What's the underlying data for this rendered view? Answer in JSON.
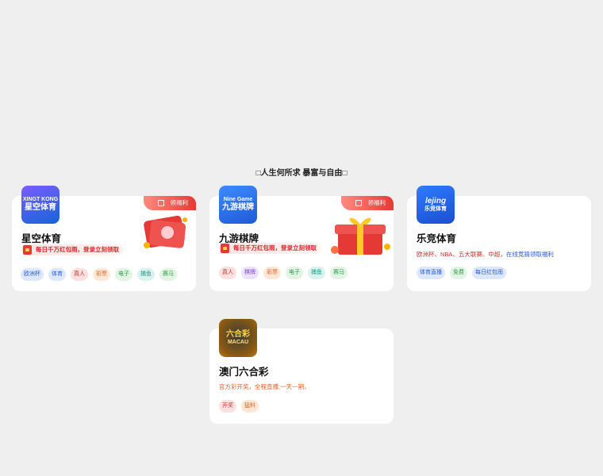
{
  "headline": "□人生何所求 暴富与自由□",
  "cards": [
    {
      "logo_line1": "XINGT KONG",
      "logo_line2": "星空体育",
      "title": "星空体育",
      "ribbon": "领福利",
      "promo": "每日千万红包雨，登录立刻领取",
      "tags": [
        "欧洲杯",
        "体育",
        "真人",
        "彩票",
        "电子",
        "捕鱼",
        "赛马"
      ]
    },
    {
      "logo_line1": "Nine Game",
      "logo_line2": "九游棋牌",
      "title": "九游棋牌",
      "ribbon": "领福利",
      "promo": "每日千万红包雨，登录立刻领取",
      "tags": [
        "真人",
        "棋牌",
        "彩票",
        "电子",
        "捕鱼",
        "赛马"
      ]
    },
    {
      "logo_line1": "lejing",
      "logo_line2": "乐竞体育",
      "title": "乐竞体育",
      "desc_red": "欧洲杯、NBA、五大联赛、中超，",
      "desc_blue": "在线竞猜领取福利",
      "tags": [
        "体育直播",
        "免费",
        "每日红包雨"
      ]
    },
    {
      "logo_line1": "六合彩",
      "logo_line2": "MACAU",
      "title": "澳门六合彩",
      "desc": "官方彩开奖，全程直播;一天一期，",
      "tags": [
        "开奖",
        "猛料"
      ]
    }
  ],
  "colors": {
    "xingkong_logo": "#1565d8",
    "jiuyou_logo": "#1e5bd6",
    "lejing_logo": "#1a4fd0",
    "lhc_logo": "#b97a1c",
    "promo_red": "#e0252b",
    "desc_orange": "#e0642a"
  }
}
